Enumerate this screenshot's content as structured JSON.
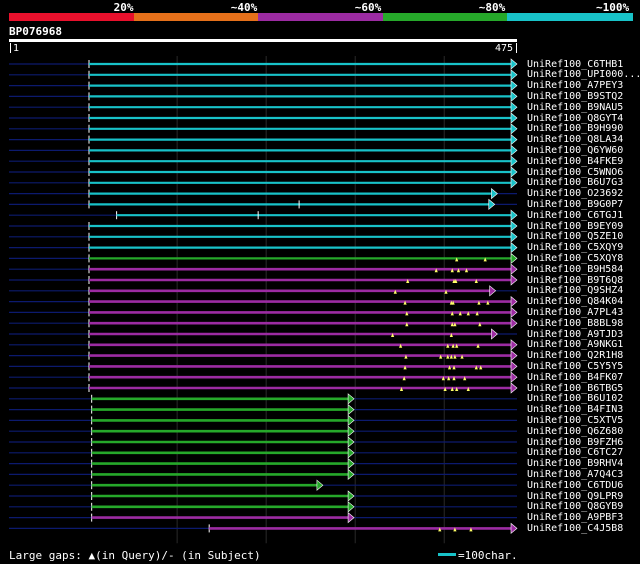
{
  "colors": {
    "background": "#000000",
    "darkline": "#0c1a6e",
    "cyan": "#18c2c8",
    "magenta": "#9c2ba2",
    "green": "#26a82a",
    "red": "#e8102c",
    "orange": "#e5701a",
    "query": "#ffffff",
    "marker": "#ffff66"
  },
  "scale": {
    "labels": [
      "20%",
      "~40%",
      "~60%",
      "~80%",
      "~100%"
    ],
    "segment_colors": [
      "#e8102c",
      "#e5701a",
      "#9c2ba2",
      "#26a82a",
      "#18c2c8"
    ]
  },
  "query": {
    "id": "BP076968",
    "start_label": "1",
    "end_label": "475",
    "length": 475
  },
  "hits": [
    {
      "name": "UniRef100_C6THB1",
      "color": "cyan",
      "start": 1,
      "end": 475,
      "arrow": true,
      "thin": true
    },
    {
      "name": "UniRef100_UPI000...",
      "color": "cyan",
      "start": 1,
      "end": 475,
      "arrow": true,
      "thin": true
    },
    {
      "name": "UniRef100_A7PEY3",
      "color": "cyan",
      "start": 1,
      "end": 475,
      "arrow": true,
      "thin": true
    },
    {
      "name": "UniRef100_B9STQ2",
      "color": "cyan",
      "start": 1,
      "end": 475,
      "arrow": true,
      "thin": true
    },
    {
      "name": "UniRef100_B9NAU5",
      "color": "cyan",
      "start": 1,
      "end": 475,
      "arrow": true,
      "thin": true
    },
    {
      "name": "UniRef100_Q8GYT4",
      "color": "cyan",
      "start": 1,
      "end": 475,
      "arrow": true,
      "thin": true
    },
    {
      "name": "UniRef100_B9H990",
      "color": "cyan",
      "start": 1,
      "end": 475,
      "arrow": true,
      "thin": true
    },
    {
      "name": "UniRef100_Q8LA34",
      "color": "cyan",
      "start": 1,
      "end": 475,
      "arrow": true,
      "thin": true
    },
    {
      "name": "UniRef100_Q6YW60",
      "color": "cyan",
      "start": 1,
      "end": 475,
      "arrow": true,
      "thin": true
    },
    {
      "name": "UniRef100_B4FKE9",
      "color": "cyan",
      "start": 1,
      "end": 475,
      "arrow": true,
      "thin": true
    },
    {
      "name": "UniRef100_C5WNO6",
      "color": "cyan",
      "start": 1,
      "end": 475,
      "arrow": true,
      "thin": true
    },
    {
      "name": "UniRef100_B6U7G3",
      "color": "cyan",
      "start": 1,
      "end": 475,
      "arrow": true,
      "thin": true
    },
    {
      "name": "UniRef100_O23692",
      "color": "cyan",
      "start": 1,
      "end": 453,
      "arrow": true,
      "thin": true
    },
    {
      "name": "UniRef100_B9G0P7",
      "color": "cyan",
      "start": 1,
      "end": 450,
      "arrow": true,
      "thin": true,
      "ticks": [
        237
      ]
    },
    {
      "name": "UniRef100_C6TGJ1",
      "color": "cyan",
      "start": 32,
      "end": 475,
      "arrow": true,
      "thin": true,
      "ticks": [
        191
      ]
    },
    {
      "name": "UniRef100_B9EY09",
      "color": "cyan",
      "start": 1,
      "end": 475,
      "arrow": true,
      "thin": true
    },
    {
      "name": "UniRef100_Q5ZE10",
      "color": "cyan",
      "start": 1,
      "end": 475,
      "arrow": true,
      "thin": true
    },
    {
      "name": "UniRef100_C5XQY9",
      "color": "cyan",
      "start": 1,
      "end": 475,
      "arrow": true,
      "thin": true
    },
    {
      "name": "UniRef100_C5XQY8",
      "color": "green",
      "start": 1,
      "end": 475,
      "arrow": true,
      "thin": true,
      "qmarks": [
        414,
        446
      ]
    },
    {
      "name": "UniRef100_B9H584",
      "color": "magenta",
      "start": 1,
      "end": 475,
      "arrow": true,
      "qmarks": [
        391,
        409,
        416,
        425
      ]
    },
    {
      "name": "UniRef100_B9T6Q8",
      "color": "magenta",
      "start": 1,
      "end": 475,
      "arrow": true,
      "qmarks": [
        359,
        411,
        413,
        436
      ]
    },
    {
      "name": "UniRef100_Q9SHZ4",
      "color": "magenta",
      "start": 1,
      "end": 451,
      "arrow": true,
      "qmarks": [
        345,
        402
      ]
    },
    {
      "name": "UniRef100_Q84K04",
      "color": "magenta",
      "start": 1,
      "end": 475,
      "arrow": true,
      "qmarks": [
        356,
        408,
        410,
        439,
        449
      ]
    },
    {
      "name": "UniRef100_A7PL43",
      "color": "magenta",
      "start": 1,
      "end": 475,
      "arrow": true,
      "qmarks": [
        358,
        409,
        418,
        427,
        437
      ]
    },
    {
      "name": "UniRef100_B8BL98",
      "color": "magenta",
      "start": 1,
      "end": 475,
      "arrow": true,
      "qmarks": [
        358,
        409,
        412,
        440
      ]
    },
    {
      "name": "UniRef100_A9TJD3",
      "color": "magenta",
      "start": 1,
      "end": 453,
      "arrow": true,
      "qmarks": [
        342,
        408
      ]
    },
    {
      "name": "UniRef100_A9NKG1",
      "color": "magenta",
      "start": 1,
      "end": 475,
      "arrow": true,
      "qmarks": [
        351,
        404,
        410,
        414,
        438
      ]
    },
    {
      "name": "UniRef100_Q2R1H8",
      "color": "magenta",
      "start": 1,
      "end": 475,
      "arrow": true,
      "qmarks": [
        357,
        396,
        404,
        408,
        412,
        420
      ]
    },
    {
      "name": "UniRef100_C5Y5Y5",
      "color": "magenta",
      "start": 1,
      "end": 475,
      "arrow": true,
      "qmarks": [
        356,
        406,
        411,
        436,
        441
      ]
    },
    {
      "name": "UniRef100_B4FK07",
      "color": "magenta",
      "start": 1,
      "end": 475,
      "arrow": true,
      "qmarks": [
        355,
        399,
        405,
        411,
        423
      ]
    },
    {
      "name": "UniRef100_B6TBG5",
      "color": "magenta",
      "start": 1,
      "end": 475,
      "arrow": true,
      "qmarks": [
        352,
        401,
        409,
        414,
        427
      ]
    },
    {
      "name": "UniRef100_B6U102",
      "color": "green",
      "start": 4,
      "end": 292,
      "arrow": true
    },
    {
      "name": "UniRef100_B4FIN3",
      "color": "green",
      "start": 4,
      "end": 292,
      "arrow": true
    },
    {
      "name": "UniRef100_C5XTV5",
      "color": "green",
      "start": 4,
      "end": 292,
      "arrow": true
    },
    {
      "name": "UniRef100_Q6Z680",
      "color": "green",
      "start": 4,
      "end": 292,
      "arrow": true
    },
    {
      "name": "UniRef100_B9FZH6",
      "color": "green",
      "start": 4,
      "end": 292,
      "arrow": true
    },
    {
      "name": "UniRef100_C6TC27",
      "color": "green",
      "start": 4,
      "end": 292,
      "arrow": true
    },
    {
      "name": "UniRef100_B9RHV4",
      "color": "green",
      "start": 4,
      "end": 292,
      "arrow": true
    },
    {
      "name": "UniRef100_A7Q4C3",
      "color": "green",
      "start": 4,
      "end": 292,
      "arrow": true
    },
    {
      "name": "UniRef100_C6TDU6",
      "color": "green",
      "start": 4,
      "end": 257,
      "arrow": true
    },
    {
      "name": "UniRef100_Q9LPR9",
      "color": "green",
      "start": 4,
      "end": 292,
      "arrow": true
    },
    {
      "name": "UniRef100_Q8GYB9",
      "color": "green",
      "start": 4,
      "end": 292,
      "arrow": true
    },
    {
      "name": "UniRef100_A9PBF3",
      "color": "magenta",
      "start": 4,
      "end": 292,
      "arrow": true
    },
    {
      "name": "UniRef100_C4J5B8",
      "color": "magenta",
      "start": 136,
      "end": 475,
      "arrow": true,
      "qmarks": [
        395,
        412,
        430
      ]
    }
  ],
  "legend": {
    "gaps_text": "Large gaps: ▲(in Query)/- (in Subject)",
    "scale_text": "=100char."
  }
}
